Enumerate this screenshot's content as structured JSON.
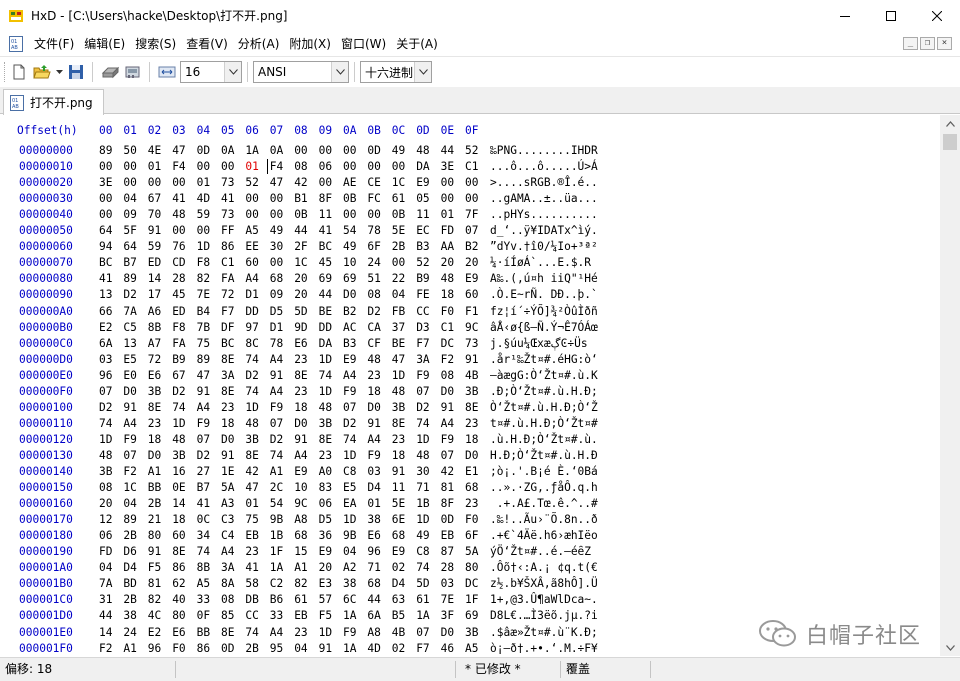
{
  "window": {
    "title": "HxD - [C:\\Users\\hacke\\Desktop\\打不开.png]",
    "minimize_icon": "minimize-icon",
    "maximize_icon": "maximize-icon",
    "close_icon": "close-icon"
  },
  "menu": {
    "items": [
      "文件(F)",
      "编辑(E)",
      "搜索(S)",
      "查看(V)",
      "分析(A)",
      "附加(X)",
      "窗口(W)",
      "关于(A)"
    ]
  },
  "toolbar": {
    "bytes_per_row": "16",
    "charset": "ANSI",
    "offset_base": "十六进制"
  },
  "tab": {
    "label": "打不开.png"
  },
  "hex": {
    "header_label": "Offset(h)",
    "header_cols": [
      "00",
      "01",
      "02",
      "03",
      "04",
      "05",
      "06",
      "07",
      "08",
      "09",
      "0A",
      "0B",
      "0C",
      "0D",
      "0E",
      "0F"
    ],
    "highlight_offset": "00000010",
    "highlight_index": 6,
    "rows": [
      {
        "off": "00000000",
        "bytes": [
          "89",
          "50",
          "4E",
          "47",
          "0D",
          "0A",
          "1A",
          "0A",
          "00",
          "00",
          "00",
          "0D",
          "49",
          "48",
          "44",
          "52"
        ],
        "ascii": "‰PNG........IHDR"
      },
      {
        "off": "00000010",
        "bytes": [
          "00",
          "00",
          "01",
          "F4",
          "00",
          "00",
          "01",
          "F4",
          "08",
          "06",
          "00",
          "00",
          "00",
          "DA",
          "3E",
          "C1"
        ],
        "ascii": "...ô...ô.....Ú>Á"
      },
      {
        "off": "00000020",
        "bytes": [
          "3E",
          "00",
          "00",
          "00",
          "01",
          "73",
          "52",
          "47",
          "42",
          "00",
          "AE",
          "CE",
          "1C",
          "E9",
          "00",
          "00"
        ],
        "ascii": ">....sRGB.®Î.é.."
      },
      {
        "off": "00000030",
        "bytes": [
          "00",
          "04",
          "67",
          "41",
          "4D",
          "41",
          "00",
          "00",
          "B1",
          "8F",
          "0B",
          "FC",
          "61",
          "05",
          "00",
          "00"
        ],
        "ascii": "..gAMA..±..üa..."
      },
      {
        "off": "00000040",
        "bytes": [
          "00",
          "09",
          "70",
          "48",
          "59",
          "73",
          "00",
          "00",
          "0B",
          "11",
          "00",
          "00",
          "0B",
          "11",
          "01",
          "7F"
        ],
        "ascii": "..pHYs.........."
      },
      {
        "off": "00000050",
        "bytes": [
          "64",
          "5F",
          "91",
          "00",
          "00",
          "FF",
          "A5",
          "49",
          "44",
          "41",
          "54",
          "78",
          "5E",
          "EC",
          "FD",
          "07"
        ],
        "ascii": "d_‘..ÿ¥IDATx^ìý."
      },
      {
        "off": "00000060",
        "bytes": [
          "94",
          "64",
          "59",
          "76",
          "1D",
          "86",
          "EE",
          "30",
          "2F",
          "BC",
          "49",
          "6F",
          "2B",
          "B3",
          "AA",
          "B2"
        ],
        "ascii": "”dYv.†î0/¼Io+³ª²"
      },
      {
        "off": "00000070",
        "bytes": [
          "BC",
          "B7",
          "ED",
          "CD",
          "F8",
          "C1",
          "60",
          "00",
          "1C",
          "45",
          "10",
          "24",
          "00",
          "52",
          "20",
          "20"
        ],
        "ascii": "¼·íÍøÁ`...E.$.R  "
      },
      {
        "off": "00000080",
        "bytes": [
          "41",
          "89",
          "14",
          "28",
          "82",
          "FA",
          "A4",
          "68",
          "20",
          "69",
          "69",
          "51",
          "22",
          "B9",
          "48",
          "E9"
        ],
        "ascii": "A‰.(‚ú¤h iiQ\"¹Hé"
      },
      {
        "off": "00000090",
        "bytes": [
          "13",
          "D2",
          "17",
          "45",
          "7E",
          "72",
          "D1",
          "09",
          "20",
          "44",
          "D0",
          "08",
          "04",
          "FE",
          "18",
          "60"
        ],
        "ascii": ".Ò.E~rÑ. DÐ..þ.`"
      },
      {
        "off": "000000A0",
        "bytes": [
          "66",
          "7A",
          "A6",
          "ED",
          "B4",
          "F7",
          "DD",
          "D5",
          "5D",
          "BE",
          "B2",
          "D2",
          "FB",
          "CC",
          "F0",
          "F1"
        ],
        "ascii": "fz¦í´÷ÝÕ]¾²ÒûÌðñ"
      },
      {
        "off": "000000B0",
        "bytes": [
          "E2",
          "C5",
          "8B",
          "F8",
          "7B",
          "DF",
          "97",
          "D1",
          "9D",
          "DD",
          "AC",
          "CA",
          "37",
          "D3",
          "C1",
          "9C"
        ],
        "ascii": "âÅ‹ø{ß—Ñ.Ý¬Ê7ÓÁœ"
      },
      {
        "off": "000000C0",
        "bytes": [
          "6A",
          "13",
          "A7",
          "FA",
          "75",
          "BC",
          "8C",
          "78",
          "E6",
          "DA",
          "B3",
          "CF",
          "BE",
          "F7",
          "DC",
          "73"
        ],
        "ascii": "j.§úu¼ŒxæڳϾ÷Üs"
      },
      {
        "off": "000000D0",
        "bytes": [
          "03",
          "E5",
          "72",
          "B9",
          "89",
          "8E",
          "74",
          "A4",
          "23",
          "1D",
          "E9",
          "48",
          "47",
          "3A",
          "F2",
          "91"
        ],
        "ascii": ".år¹‰Žt¤#.éHG:ò‘"
      },
      {
        "off": "000000E0",
        "bytes": [
          "96",
          "E0",
          "E6",
          "67",
          "47",
          "3A",
          "D2",
          "91",
          "8E",
          "74",
          "A4",
          "23",
          "1D",
          "F9",
          "08",
          "4B"
        ],
        "ascii": "–àægG:Ò‘Žt¤#.ù.K"
      },
      {
        "off": "000000F0",
        "bytes": [
          "07",
          "D0",
          "3B",
          "D2",
          "91",
          "8E",
          "74",
          "A4",
          "23",
          "1D",
          "F9",
          "18",
          "48",
          "07",
          "D0",
          "3B"
        ],
        "ascii": ".Ð;Ò‘Žt¤#.ù.H.Ð;"
      },
      {
        "off": "00000100",
        "bytes": [
          "D2",
          "91",
          "8E",
          "74",
          "A4",
          "23",
          "1D",
          "F9",
          "18",
          "48",
          "07",
          "D0",
          "3B",
          "D2",
          "91",
          "8E"
        ],
        "ascii": "Ò‘Žt¤#.ù.H.Ð;Ò‘Ž"
      },
      {
        "off": "00000110",
        "bytes": [
          "74",
          "A4",
          "23",
          "1D",
          "F9",
          "18",
          "48",
          "07",
          "D0",
          "3B",
          "D2",
          "91",
          "8E",
          "74",
          "A4",
          "23"
        ],
        "ascii": "t¤#.ù.H.Ð;Ò‘Žt¤#"
      },
      {
        "off": "00000120",
        "bytes": [
          "1D",
          "F9",
          "18",
          "48",
          "07",
          "D0",
          "3B",
          "D2",
          "91",
          "8E",
          "74",
          "A4",
          "23",
          "1D",
          "F9",
          "18"
        ],
        "ascii": ".ù.H.Ð;Ò‘Žt¤#.ù."
      },
      {
        "off": "00000130",
        "bytes": [
          "48",
          "07",
          "D0",
          "3B",
          "D2",
          "91",
          "8E",
          "74",
          "A4",
          "23",
          "1D",
          "F9",
          "18",
          "48",
          "07",
          "D0"
        ],
        "ascii": "H.Ð;Ò‘Žt¤#.ù.H.Ð"
      },
      {
        "off": "00000140",
        "bytes": [
          "3B",
          "F2",
          "A1",
          "16",
          "27",
          "1E",
          "42",
          "A1",
          "E9",
          "A0",
          "C8",
          "03",
          "91",
          "30",
          "42",
          "E1"
        ],
        "ascii": ";ò¡.'.B¡é È.‘0Bá"
      },
      {
        "off": "00000150",
        "bytes": [
          "08",
          "1C",
          "BB",
          "0E",
          "B7",
          "5A",
          "47",
          "2C",
          "10",
          "83",
          "E5",
          "D4",
          "11",
          "71",
          "81",
          "68"
        ],
        "ascii": "..».·ZG,.ƒåÔ.q.h"
      },
      {
        "off": "00000160",
        "bytes": [
          "20",
          "04",
          "2B",
          "14",
          "41",
          "A3",
          "01",
          "54",
          "9C",
          "06",
          "EA",
          "01",
          "5E",
          "1B",
          "8F",
          "23"
        ],
        "ascii": " .+.A£.Tœ.ê.^..#"
      },
      {
        "off": "00000170",
        "bytes": [
          "12",
          "89",
          "21",
          "18",
          "0C",
          "C3",
          "75",
          "9B",
          "A8",
          "D5",
          "1D",
          "38",
          "6E",
          "1D",
          "0D",
          "F0"
        ],
        "ascii": ".‰!..Ãu›¨Õ.8n..ð"
      },
      {
        "off": "00000180",
        "bytes": [
          "06",
          "2B",
          "80",
          "60",
          "34",
          "C4",
          "EB",
          "1B",
          "68",
          "36",
          "9B",
          "E6",
          "68",
          "49",
          "EB",
          "6F"
        ],
        "ascii": ".+€`4Äë.h6›æhIëo"
      },
      {
        "off": "00000190",
        "bytes": [
          "FD",
          "D6",
          "91",
          "8E",
          "74",
          "A4",
          "23",
          "1F",
          "15",
          "E9",
          "04",
          "96",
          "E9",
          "C8",
          "87",
          "5A"
        ],
        "ascii": "ýÖ‘Žt¤#..é.–éȇZ"
      },
      {
        "off": "000001A0",
        "bytes": [
          "04",
          "D4",
          "F5",
          "86",
          "8B",
          "3A",
          "41",
          "1A",
          "A1",
          "20",
          "A2",
          "71",
          "02",
          "74",
          "28",
          "80"
        ],
        "ascii": ".Ôõ†‹:A.¡ ¢q.t(€"
      },
      {
        "off": "000001B0",
        "bytes": [
          "7A",
          "BD",
          "81",
          "62",
          "A5",
          "8A",
          "58",
          "C2",
          "82",
          "E3",
          "38",
          "68",
          "D4",
          "5D",
          "03",
          "DC"
        ],
        "ascii": "z½.b¥ŠXÂ‚ã8hÔ].Ü"
      },
      {
        "off": "000001C0",
        "bytes": [
          "31",
          "2B",
          "82",
          "40",
          "33",
          "08",
          "DB",
          "B6",
          "61",
          "57",
          "6C",
          "44",
          "63",
          "61",
          "7E",
          "1F"
        ],
        "ascii": "1+‚@3.Û¶aWlDca~."
      },
      {
        "off": "000001D0",
        "bytes": [
          "44",
          "38",
          "4C",
          "80",
          "0F",
          "85",
          "CC",
          "33",
          "EB",
          "F5",
          "1A",
          "6A",
          "B5",
          "1A",
          "3F",
          "69"
        ],
        "ascii": "D8L€.…Ì3ëõ.jµ.?i"
      },
      {
        "off": "000001E0",
        "bytes": [
          "14",
          "24",
          "E2",
          "E6",
          "BB",
          "8E",
          "74",
          "A4",
          "23",
          "1D",
          "F9",
          "A8",
          "4B",
          "07",
          "D0",
          "3B"
        ],
        "ascii": ".$âæ»Žt¤#.ù¨K.Ð;"
      },
      {
        "off": "000001F0",
        "bytes": [
          "F2",
          "A1",
          "96",
          "F0",
          "86",
          "0D",
          "2B",
          "95",
          "04",
          "91",
          "1A",
          "4D",
          "02",
          "F7",
          "46",
          "A5"
        ],
        "ascii": "ò¡–ð†.+•.‘.M.÷F¥"
      }
    ]
  },
  "status": {
    "offset": "偏移:  18",
    "modified": "* 已修改 *",
    "mode": "覆盖"
  },
  "watermark": {
    "text": "白帽子社区"
  }
}
